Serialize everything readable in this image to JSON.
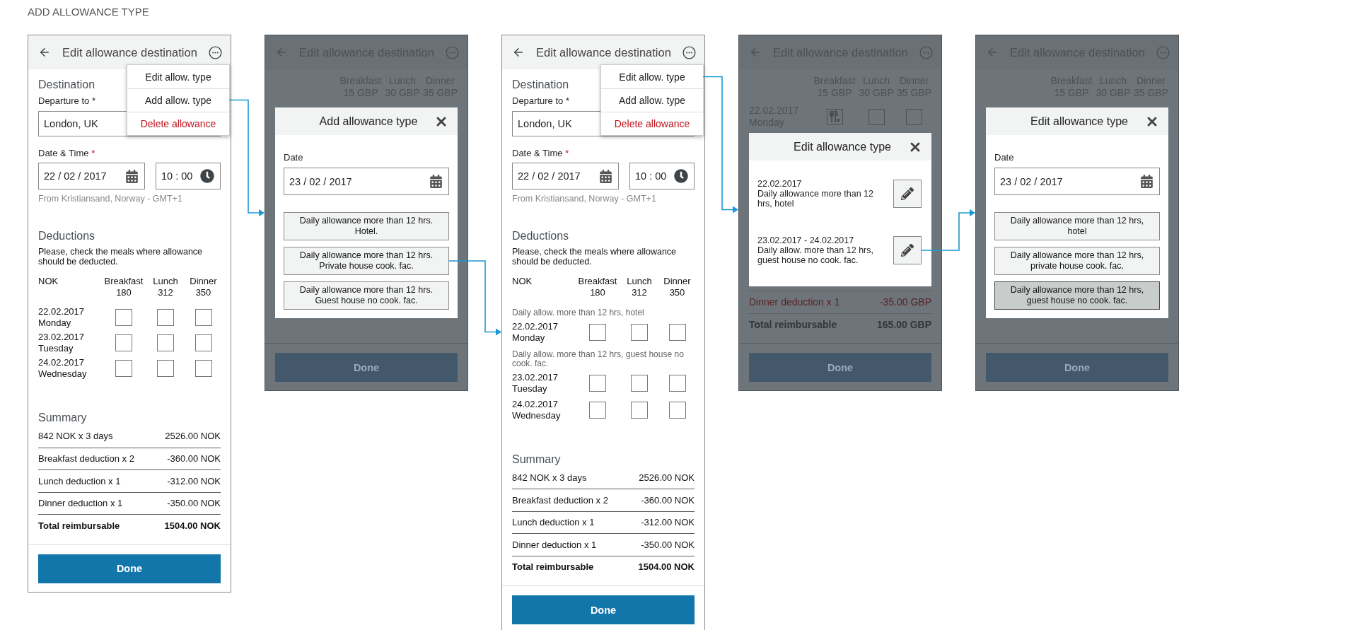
{
  "page_title": "ADD ALLOWANCE TYPE",
  "screens": [
    {
      "kind": "form",
      "title": "Edit allowance destination",
      "menu": [
        {
          "label": "Edit allow. type",
          "kind": "normal"
        },
        {
          "label": "Add allow. type",
          "kind": "normal",
          "link": true
        },
        {
          "label": "Delete allowance",
          "kind": "danger"
        }
      ],
      "destination_heading": "Destination",
      "departure": {
        "label": "Departure to",
        "mark": "*",
        "mark_alert": false,
        "value": "London, UK"
      },
      "datetime": {
        "label": "Date & Time",
        "mark": "*",
        "mark_alert": true,
        "date": "22 / 02 / 2017",
        "time": "10 : 00",
        "hint": "From Kristiansand, Norway - GMT+1"
      },
      "deductions": {
        "heading": "Deductions",
        "text": "Please, check the meals where allowance should be deducted.",
        "currency": "NOK",
        "meals": [
          {
            "name": "Breakfast",
            "price": "180"
          },
          {
            "name": "Lunch",
            "price": "312"
          },
          {
            "name": "Dinner",
            "price": "350"
          }
        ],
        "groups": [
          {
            "rows": [
              {
                "date": "22.02.2017",
                "day": "Monday",
                "checks": [
                  {
                    "checked": false
                  },
                  {
                    "checked": false
                  },
                  {
                    "checked": false
                  }
                ]
              },
              {
                "date": "23.02.2017",
                "day": "Tuesday",
                "checks": [
                  {
                    "checked": false
                  },
                  {
                    "checked": false
                  },
                  {
                    "checked": false
                  }
                ]
              },
              {
                "date": "24.02.2017",
                "day": "Wednesday",
                "checks": [
                  {
                    "checked": false
                  },
                  {
                    "checked": false
                  },
                  {
                    "checked": false
                  }
                ]
              }
            ]
          }
        ]
      },
      "summary": {
        "heading": "Summary",
        "rows": [
          {
            "label": "842 NOK x 3 days",
            "amount": "2526.00 NOK",
            "kind": "line"
          },
          {
            "label": "Breakfast deduction x 2",
            "amount": "-360.00 NOK",
            "kind": "line"
          },
          {
            "label": "Lunch deduction x 1",
            "amount": "-312.00 NOK",
            "kind": "line"
          },
          {
            "label": "Dinner deduction x 1",
            "amount": "-350.00 NOK",
            "kind": "line"
          },
          {
            "label": "Total reimbursable",
            "amount": "1504.00 NOK",
            "kind": "total"
          }
        ]
      },
      "done": "Done"
    },
    {
      "kind": "dimmed",
      "title": "Edit allowance destination",
      "meals": [
        {
          "name": "Breakfast",
          "price": "15 GBP"
        },
        {
          "name": "Lunch",
          "price": "30 GBP"
        },
        {
          "name": "Dinner",
          "price": "35 GBP"
        }
      ],
      "done": "Done",
      "dialog": {
        "kind": "choose",
        "title": "Add allowance type",
        "date_label": "Date",
        "date": "23 / 02 / 2017",
        "options": [
          {
            "label": "Daily allowance more than 12 hrs.\nHotel.",
            "selected": false
          },
          {
            "label": "Daily allowance more than 12 hrs.\nPrivate house cook. fac.",
            "selected": false,
            "link": true
          },
          {
            "label": "Daily allowance more than 12 hrs.\nGuest house no cook. fac.",
            "selected": false
          }
        ]
      }
    },
    {
      "kind": "form",
      "title": "Edit allowance destination",
      "menu": [
        {
          "label": "Edit allow. type",
          "kind": "normal",
          "link": true
        },
        {
          "label": "Add allow. type",
          "kind": "normal"
        },
        {
          "label": "Delete allowance",
          "kind": "danger"
        }
      ],
      "destination_heading": "Destination",
      "departure": {
        "label": "Departure to",
        "mark": "*",
        "mark_alert": false,
        "value": "London, UK"
      },
      "datetime": {
        "label": "Date & Time",
        "mark": "*",
        "mark_alert": true,
        "date": "22 / 02 / 2017",
        "time": "10 : 00",
        "hint": "From Kristiansand, Norway - GMT+1"
      },
      "deductions": {
        "heading": "Deductions",
        "text": "Please, check the meals where allowance should be deducted.",
        "currency": "NOK",
        "meals": [
          {
            "name": "Breakfast",
            "price": "180"
          },
          {
            "name": "Lunch",
            "price": "312"
          },
          {
            "name": "Dinner",
            "price": "350"
          }
        ],
        "groups": [
          {
            "note": "Daily allow. more than 12 hrs, hotel",
            "rows": [
              {
                "date": "22.02.2017",
                "day": "Monday",
                "checks": [
                  {
                    "checked": false
                  },
                  {
                    "checked": false
                  },
                  {
                    "checked": false
                  }
                ]
              }
            ]
          },
          {
            "note": "Daily allow. more than 12 hrs, guest house no cook. fac.",
            "rows": [
              {
                "date": "23.02.2017",
                "day": "Tuesday",
                "checks": [
                  {
                    "checked": false
                  },
                  {
                    "checked": false
                  },
                  {
                    "checked": false
                  }
                ]
              },
              {
                "date": "24.02.2017",
                "day": "Wednesday",
                "checks": [
                  {
                    "checked": false
                  },
                  {
                    "checked": false
                  },
                  {
                    "checked": false
                  }
                ]
              }
            ]
          }
        ]
      },
      "summary": {
        "heading": "Summary",
        "rows": [
          {
            "label": "842 NOK x 3 days",
            "amount": "2526.00 NOK",
            "kind": "line"
          },
          {
            "label": "Breakfast deduction x 2",
            "amount": "-360.00 NOK",
            "kind": "line"
          },
          {
            "label": "Lunch deduction x 1",
            "amount": "-312.00 NOK",
            "kind": "line"
          },
          {
            "label": "Dinner deduction x 1",
            "amount": "-350.00 NOK",
            "kind": "line"
          },
          {
            "label": "Total reimbursable",
            "amount": "1504.00 NOK",
            "kind": "total"
          }
        ]
      },
      "done": "Done"
    },
    {
      "kind": "dimmed",
      "title": "Edit allowance destination",
      "meals": [
        {
          "name": "Breakfast",
          "price": "15 GBP"
        },
        {
          "name": "Lunch",
          "price": "30 GBP"
        },
        {
          "name": "Dinner",
          "price": "35 GBP"
        }
      ],
      "rows": [
        {
          "date": "22.02.2017",
          "day": "Monday",
          "checks": [
            {
              "checked": true
            },
            {
              "checked": false
            },
            {
              "checked": false
            }
          ]
        }
      ],
      "summary": [
        {
          "label": "Dinner deduction x 1",
          "amount": "-35.00 GBP",
          "kind": "alert"
        },
        {
          "label": "Total reimbursable",
          "amount": "165.00 GBP",
          "kind": "total"
        }
      ],
      "done": "Done",
      "dialog": {
        "kind": "entries",
        "title": "Edit allowance type",
        "entries": [
          {
            "date": "22.02.2017",
            "text": "Daily allowance more than 12 hrs, hotel"
          },
          {
            "date": "23.02.2017 - 24.02.2017",
            "text": "Daily allow. more than 12 hrs, guest house no cook. fac.",
            "link": true
          }
        ]
      }
    },
    {
      "kind": "dimmed",
      "title": "Edit allowance destination",
      "meals": [
        {
          "name": "Breakfast",
          "price": "15 GBP"
        },
        {
          "name": "Lunch",
          "price": "30 GBP"
        },
        {
          "name": "Dinner",
          "price": "35 GBP"
        }
      ],
      "done": "Done",
      "dialog": {
        "kind": "choose",
        "title": "Edit allowance type",
        "date_label": "Date",
        "date": "23 / 02 / 2017",
        "options": [
          {
            "label": "Daily allowance more than 12 hrs,\nhotel",
            "selected": false
          },
          {
            "label": "Daily allowance more than 12 hrs,\nprivate house cook. fac.",
            "selected": false
          },
          {
            "label": "Daily allowance more than 12 hrs,\nguest house no cook. fac.",
            "selected": true
          }
        ]
      }
    }
  ]
}
